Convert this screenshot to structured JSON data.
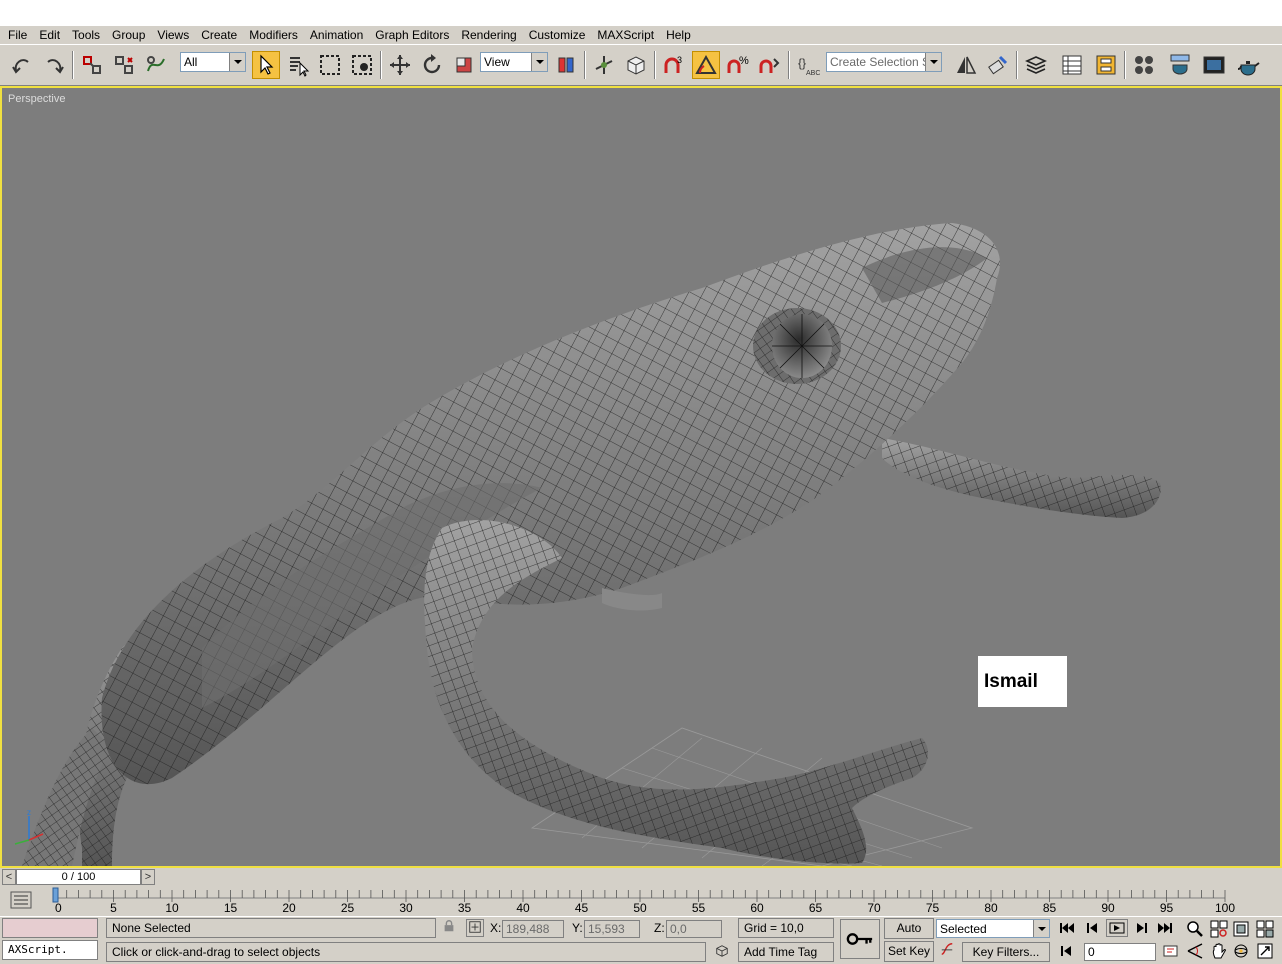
{
  "menu": [
    "File",
    "Edit",
    "Tools",
    "Group",
    "Views",
    "Create",
    "Modifiers",
    "Animation",
    "Graph Editors",
    "Rendering",
    "Customize",
    "MAXScript",
    "Help"
  ],
  "toolbar": {
    "filter_value": "All",
    "refcoord_value": "View",
    "selection_set_placeholder": "Create Selection Set"
  },
  "viewport": {
    "label": "Perspective",
    "name_tag": "Ismail"
  },
  "time_slider": {
    "value": "0 / 100",
    "prev_glyph": "<",
    "next_glyph": ">"
  },
  "trackbar": {
    "ticks": [
      "0",
      "5",
      "10",
      "15",
      "20",
      "25",
      "30",
      "35",
      "40",
      "45",
      "50",
      "55",
      "60",
      "65",
      "70",
      "75",
      "80",
      "85",
      "90",
      "95",
      "100"
    ],
    "start": 0,
    "end": 100,
    "current": 0
  },
  "status": {
    "maxscript_label": "AXScript.",
    "selection_status": "None Selected",
    "prompt": "Click or click-and-drag to select objects",
    "x_label": "X:",
    "x_value": "189,488",
    "y_label": "Y:",
    "y_value": "15,593",
    "z_label": "Z:",
    "z_value": "0,0",
    "grid": "Grid = 10,0",
    "add_time_tag": "Add Time Tag",
    "auto_key": "Auto Key",
    "set_key": "Set Key",
    "key_mode_value": "Selected",
    "key_filters": "Key Filters...",
    "frame_value": "0"
  },
  "colors": {
    "ui_face": "#d4d0c8",
    "viewport_bg": "#7d7d7d",
    "viewport_border": "#f0e040",
    "active_tool": "#f5c242",
    "mesh_fill": "#8a8a8a",
    "mesh_wire": "#1e1e1e"
  }
}
